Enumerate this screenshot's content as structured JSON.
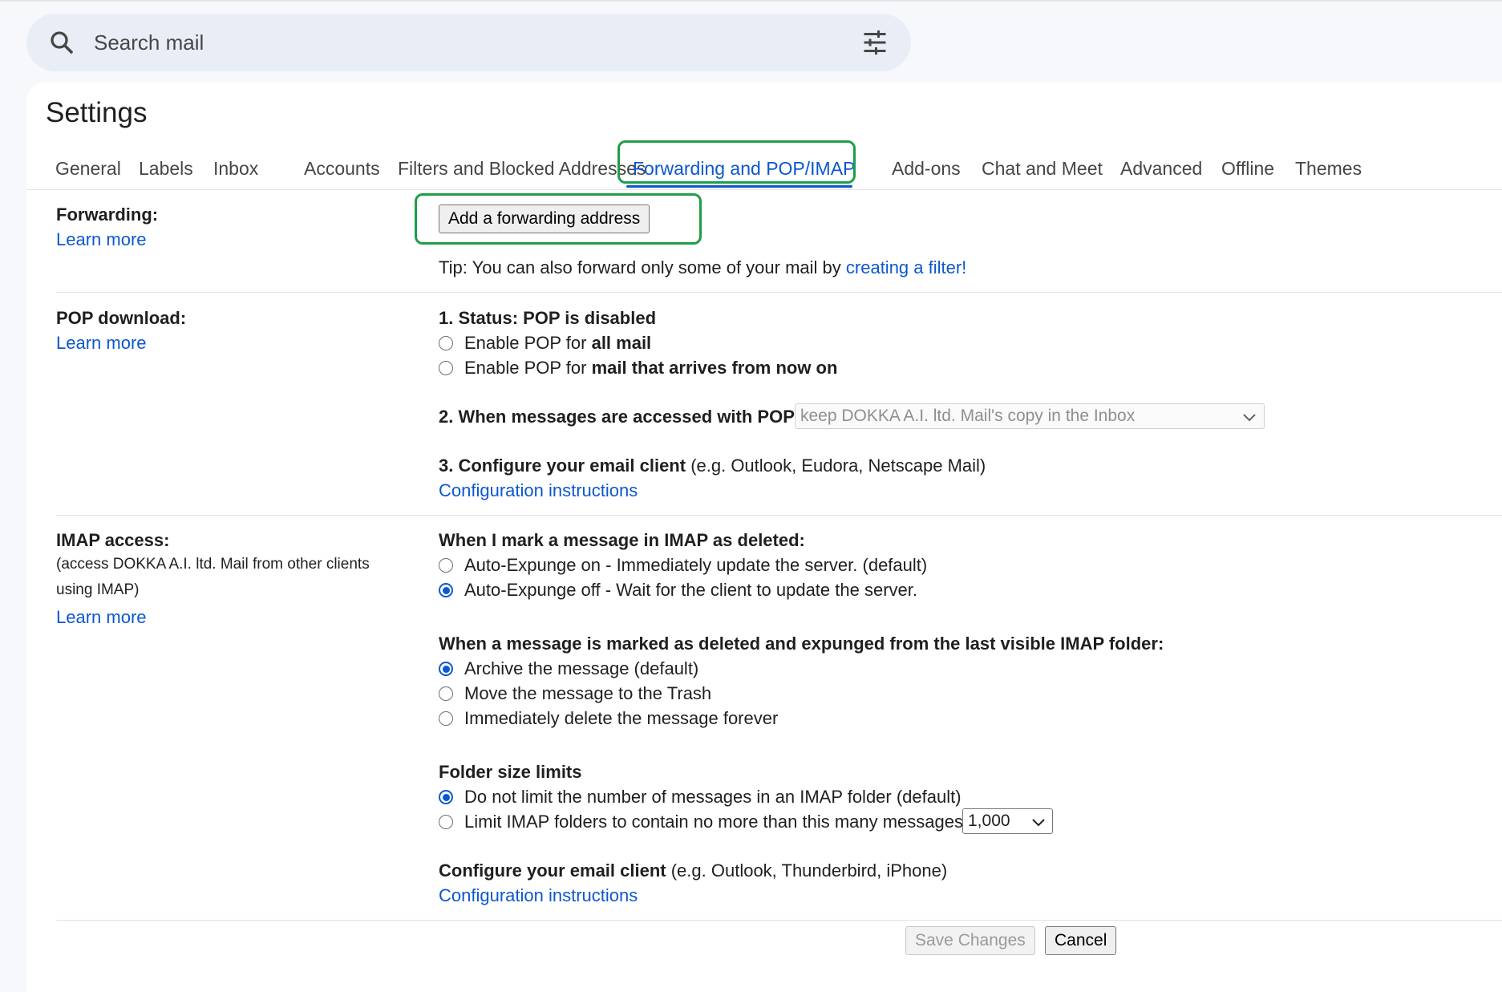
{
  "search": {
    "placeholder": "Search mail"
  },
  "settings_title": "Settings",
  "tabs": [
    {
      "label": "General"
    },
    {
      "label": "Labels"
    },
    {
      "label": "Inbox"
    },
    {
      "label": "Accounts"
    },
    {
      "label": "Filters and Blocked Addresses"
    },
    {
      "label": "Forwarding and POP/IMAP",
      "active": true
    },
    {
      "label": "Add-ons"
    },
    {
      "label": "Chat and Meet"
    },
    {
      "label": "Advanced"
    },
    {
      "label": "Offline"
    },
    {
      "label": "Themes"
    }
  ],
  "forwarding": {
    "label": "Forwarding:",
    "learn_more": "Learn more",
    "add_button": "Add a forwarding address",
    "tip_prefix": "Tip: You can also forward only some of your mail by ",
    "tip_link": "creating a filter!"
  },
  "pop": {
    "label": "POP download:",
    "learn_more": "Learn more",
    "status": "1. Status: POP is disabled",
    "option1_prefix": "Enable POP for ",
    "option1_bold": "all mail",
    "option2_prefix": "Enable POP for ",
    "option2_bold": "mail that arrives from now on",
    "when_accessed": "2. When messages are accessed with POP",
    "when_accessed_value": "keep DOKKA A.I. ltd. Mail's copy in the Inbox",
    "configure_bold": "3. Configure your email client",
    "configure_rest": " (e.g. Outlook, Eudora, Netscape Mail)",
    "config_link": "Configuration instructions"
  },
  "imap": {
    "label": "IMAP access:",
    "sublabel": "(access DOKKA A.I. ltd. Mail from other clients using IMAP)",
    "learn_more": "Learn more",
    "deleted_heading": "When I mark a message in IMAP as deleted:",
    "deleted_options": [
      {
        "label": "Auto-Expunge on - Immediately update the server. (default)",
        "selected": false
      },
      {
        "label": "Auto-Expunge off - Wait for the client to update the server.",
        "selected": true
      }
    ],
    "expunged_heading": "When a message is marked as deleted and expunged from the last visible IMAP folder:",
    "expunged_options": [
      {
        "label": "Archive the message (default)",
        "selected": true
      },
      {
        "label": "Move the message to the Trash",
        "selected": false
      },
      {
        "label": "Immediately delete the message forever",
        "selected": false
      }
    ],
    "folder_heading": "Folder size limits",
    "folder_options": [
      {
        "label": "Do not limit the number of messages in an IMAP folder (default)",
        "selected": true
      },
      {
        "label": "Limit IMAP folders to contain no more than this many messages",
        "selected": false
      }
    ],
    "folder_limit_value": "1,000",
    "configure_bold": "Configure your email client",
    "configure_rest": " (e.g. Outlook, Thunderbird, iPhone)",
    "config_link": "Configuration instructions"
  },
  "footer": {
    "save": "Save Changes",
    "cancel": "Cancel"
  },
  "colors": {
    "accent": "#0b57d0",
    "highlight": "#1e9e48"
  }
}
